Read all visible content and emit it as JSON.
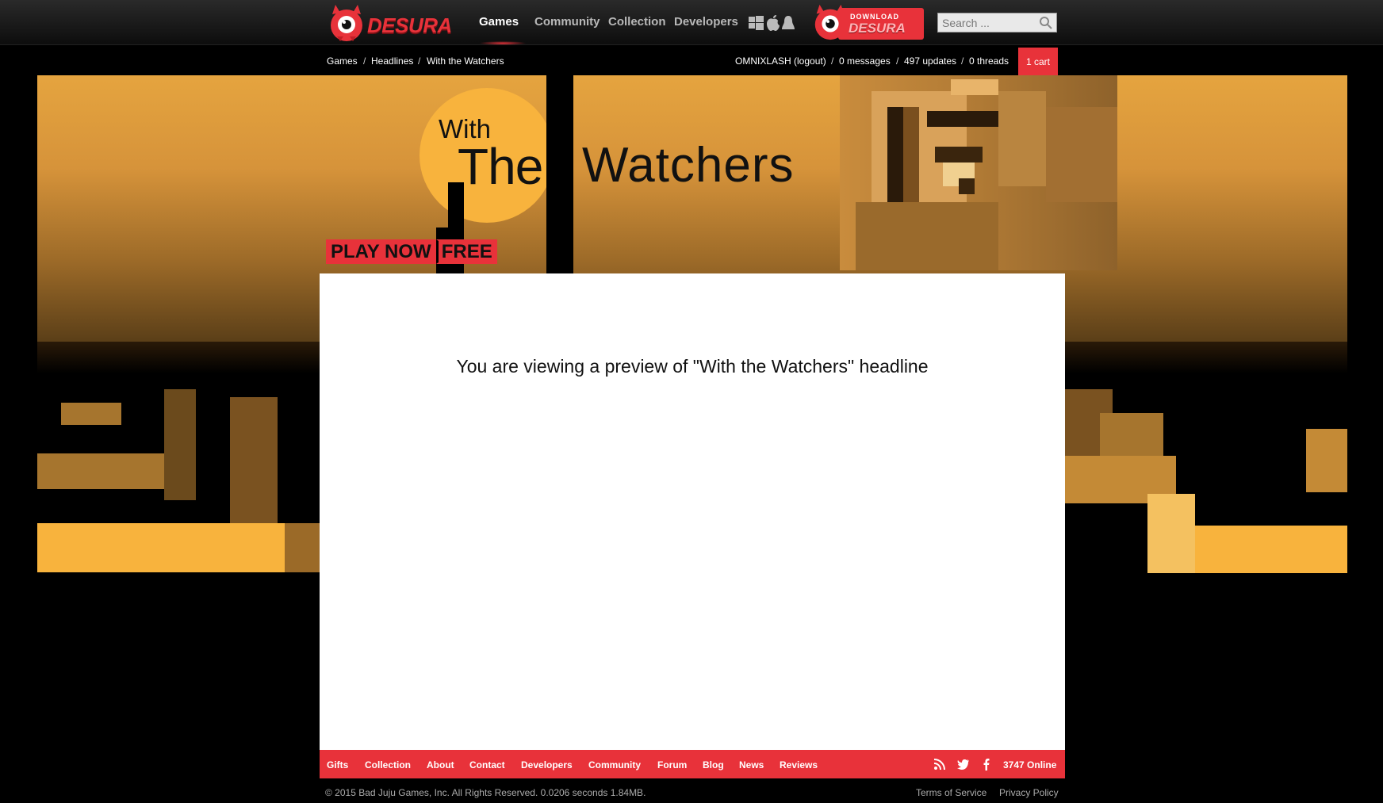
{
  "header": {
    "logo_text": "DESURA",
    "nav": [
      "Games",
      "Community",
      "Collection",
      "Developers"
    ],
    "active_nav": "Games",
    "download": {
      "line1": "DOWNLOAD",
      "line2": "DESURA"
    },
    "search_placeholder": "Search ..."
  },
  "breadcrumb": [
    "Games",
    "Headlines",
    "With the Watchers"
  ],
  "user": {
    "name": "OMNIXLASH (logout)",
    "messages": "0 messages",
    "updates": "497 updates",
    "threads": "0 threads",
    "cart": "1 cart"
  },
  "banner": {
    "title_with": "With",
    "title_the": "The",
    "title_watchers": "Watchers",
    "play_now": "PLAY NOW",
    "free": "FREE"
  },
  "content": {
    "preview_text": "You are viewing a preview of \"With the Watchers\" headline"
  },
  "footer": {
    "links": [
      "Gifts",
      "Collection",
      "About",
      "Contact",
      "Developers",
      "Community",
      "Forum",
      "Blog",
      "News",
      "Reviews"
    ],
    "online": "3747 Online",
    "copyright": "© 2015 Bad Juju Games, Inc.   All Rights Reserved.   0.0206 seconds 1.84MB.",
    "terms": "Terms of Service",
    "privacy": "Privacy Policy"
  },
  "colors": {
    "accent": "#e8323a",
    "banner_gold": "#f8b33d"
  }
}
